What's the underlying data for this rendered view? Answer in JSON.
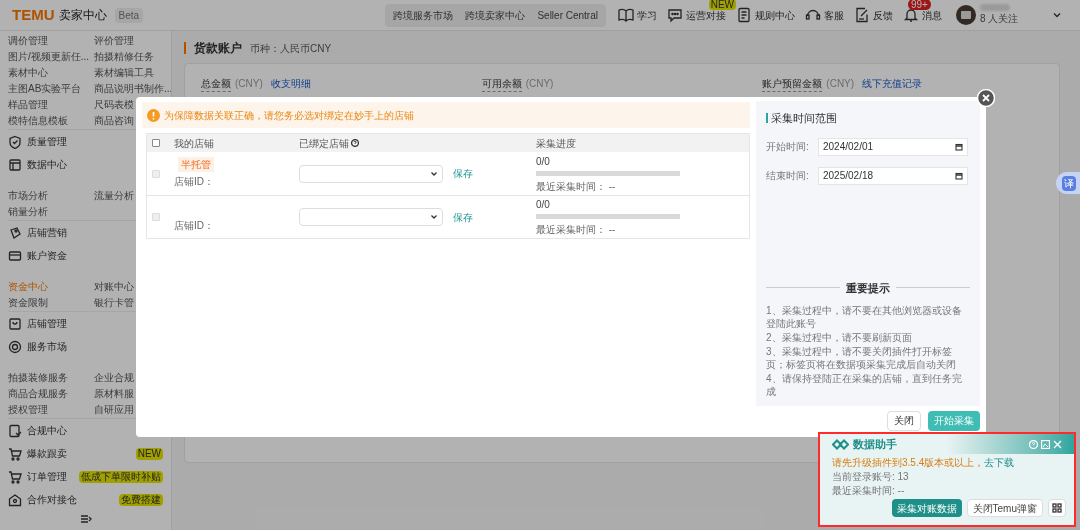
{
  "header": {
    "logo": "TEMU",
    "product": "卖家中心",
    "beta": "Beta",
    "switcher": [
      {
        "label": "跨境服务市场",
        "selected": false
      },
      {
        "label": "跨境卖家中心",
        "selected": false
      },
      {
        "label": "Seller Central",
        "selected": false
      }
    ],
    "nav": [
      {
        "label": "学习"
      },
      {
        "label": "运营对接",
        "badge": "NEW"
      },
      {
        "label": "规则中心"
      },
      {
        "label": "客服"
      },
      {
        "label": "反馈"
      },
      {
        "label": "消息",
        "badge": "99+"
      }
    ],
    "user": {
      "followers": "8 人关注"
    }
  },
  "sidebar": [
    {
      "kind": "links",
      "links": [
        {
          "label": "调价管理",
          "selected": false
        },
        {
          "label": "评价管理",
          "selected": false
        }
      ]
    },
    {
      "kind": "links",
      "links": [
        {
          "label": "图片/视频更新任...",
          "selected": false
        },
        {
          "label": "拍摄精修任务",
          "selected": false
        }
      ]
    },
    {
      "kind": "links",
      "links": [
        {
          "label": "素材中心",
          "selected": false
        },
        {
          "label": "素材编辑工具",
          "selected": false
        }
      ]
    },
    {
      "kind": "links",
      "links": [
        {
          "label": "主图AB实验平台",
          "selected": false
        },
        {
          "label": "商品说明书制作...",
          "selected": false
        }
      ]
    },
    {
      "kind": "links",
      "links": [
        {
          "label": "样品管理",
          "selected": false
        },
        {
          "label": "尺码表模",
          "selected": false
        }
      ]
    },
    {
      "kind": "links",
      "links": [
        {
          "label": "模特信息模板",
          "selected": false
        },
        {
          "label": "商品咨询",
          "selected": false
        }
      ]
    },
    {
      "kind": "header",
      "label": "质量管理"
    },
    {
      "kind": "header",
      "label": "数据中心"
    },
    {
      "kind": "links",
      "links": [
        {
          "label": "市场分析",
          "selected": false
        },
        {
          "label": "流量分析",
          "selected": false
        }
      ]
    },
    {
      "kind": "links",
      "links": [
        {
          "label": "销量分析",
          "selected": false
        }
      ]
    },
    {
      "kind": "header",
      "label": "店铺营销"
    },
    {
      "kind": "header",
      "label": "账户资金"
    },
    {
      "kind": "links",
      "links": [
        {
          "label": "资金中心",
          "selected": true
        },
        {
          "label": "对账中心",
          "selected": false
        }
      ]
    },
    {
      "kind": "links",
      "links": [
        {
          "label": "资金限制",
          "selected": false
        },
        {
          "label": "银行卡管",
          "selected": false
        }
      ]
    },
    {
      "kind": "header",
      "label": "店铺管理"
    },
    {
      "kind": "header",
      "label": "服务市场"
    },
    {
      "kind": "links",
      "links": [
        {
          "label": "拍摄装修服务",
          "selected": false
        },
        {
          "label": "企业合规",
          "selected": false
        }
      ]
    },
    {
      "kind": "links",
      "links": [
        {
          "label": "商品合规服务",
          "selected": false
        },
        {
          "label": "原材料服",
          "selected": false
        }
      ]
    },
    {
      "kind": "links",
      "links": [
        {
          "label": "授权管理",
          "selected": false
        },
        {
          "label": "自研应用",
          "selected": false
        }
      ]
    },
    {
      "kind": "header",
      "label": "合规中心"
    },
    {
      "kind": "header",
      "label": "爆款跟卖",
      "badge": "NEW"
    },
    {
      "kind": "header",
      "label": "订单管理",
      "badge": "低成下单限时补贴"
    },
    {
      "kind": "header",
      "label": "合作对接仓",
      "badge": "免费搭建"
    }
  ],
  "account": {
    "title": "货款账户",
    "currency": "币种：人民币CNY",
    "stats": [
      {
        "label": "总金额",
        "unit": "(CNY)",
        "link": "收支明细"
      },
      {
        "label": "可用余额",
        "unit": "(CNY)"
      },
      {
        "label": "账户预留金额",
        "unit": "(CNY)",
        "link": "线下充值记录"
      }
    ]
  },
  "translate_button": "译",
  "dialog": {
    "warning": "为保障数据关联正确，请您务必选对绑定在妙手上的店铺",
    "columns": [
      "我的店铺",
      "已绑定店铺",
      "采集进度"
    ],
    "select_all": {
      "checked": false
    },
    "rows": [
      {
        "disabled": true,
        "tag": "半托管",
        "id_label": "店铺ID：",
        "save": "保存",
        "progress": "0/0",
        "level": 0,
        "last_time": "最近采集时间： --"
      },
      {
        "disabled": true,
        "id_label": "店铺ID：",
        "save": "保存",
        "progress": "0/0",
        "level": 0,
        "last_time": "最近采集时间： --"
      }
    ],
    "range": {
      "title": "采集时间范围",
      "fields": [
        {
          "label": "开始时间:",
          "value": "2024/02/01"
        },
        {
          "label": "结束时间:",
          "value": "2025/02/18"
        }
      ]
    },
    "notice": {
      "title": "重要提示",
      "lines": [
        "1、采集过程中，请不要在其他浏览器或设备登陆此账号",
        "2、采集过程中，请不要刷新页面",
        "3、采集过程中，请不要关闭插件打开标签页；标签页将在数据项采集完成后自动关闭",
        "4、请保持登陆正在采集的店铺，直到任务完成"
      ]
    },
    "buttons": [
      "关闭",
      "开始采集"
    ]
  },
  "helper": {
    "title": "数据助手",
    "upgrade": "请先升级插件到3.5.4版本或以上，",
    "download": "去下载",
    "account": "当前登录账号: 13",
    "last_time": "最近采集时间: --",
    "buttons": [
      "采集对账数据",
      "关闭Temu弹窗"
    ]
  }
}
